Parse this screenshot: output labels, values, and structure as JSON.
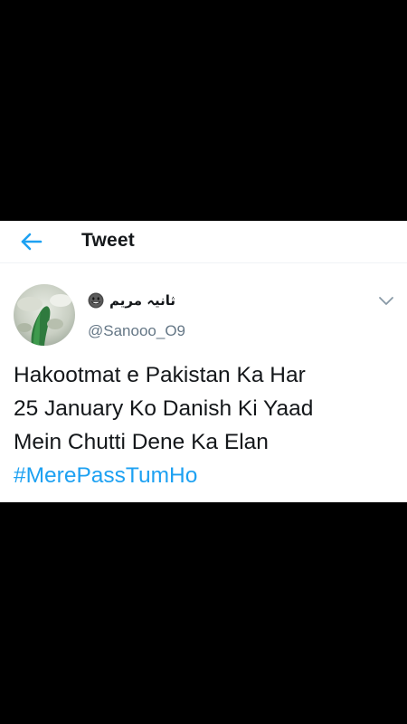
{
  "header": {
    "title": "Tweet",
    "back_icon": "arrow-left-icon"
  },
  "author": {
    "display_name": "ثانیہ مریم",
    "emoji_icon": "grinning-face-icon",
    "handle": "@Sanooo_O9",
    "menu_icon": "chevron-down-icon"
  },
  "tweet": {
    "lines": [
      "Hakootmat e Pakistan Ka Har",
      "25 January Ko Danish Ki Yaad",
      "Mein Chutti Dene Ka Elan"
    ],
    "hashtag": "#MerePassTumHo"
  },
  "colors": {
    "accent": "#1da1f2",
    "text": "#14171a",
    "secondary_text": "#657786",
    "background": "#000000",
    "card": "#ffffff"
  }
}
